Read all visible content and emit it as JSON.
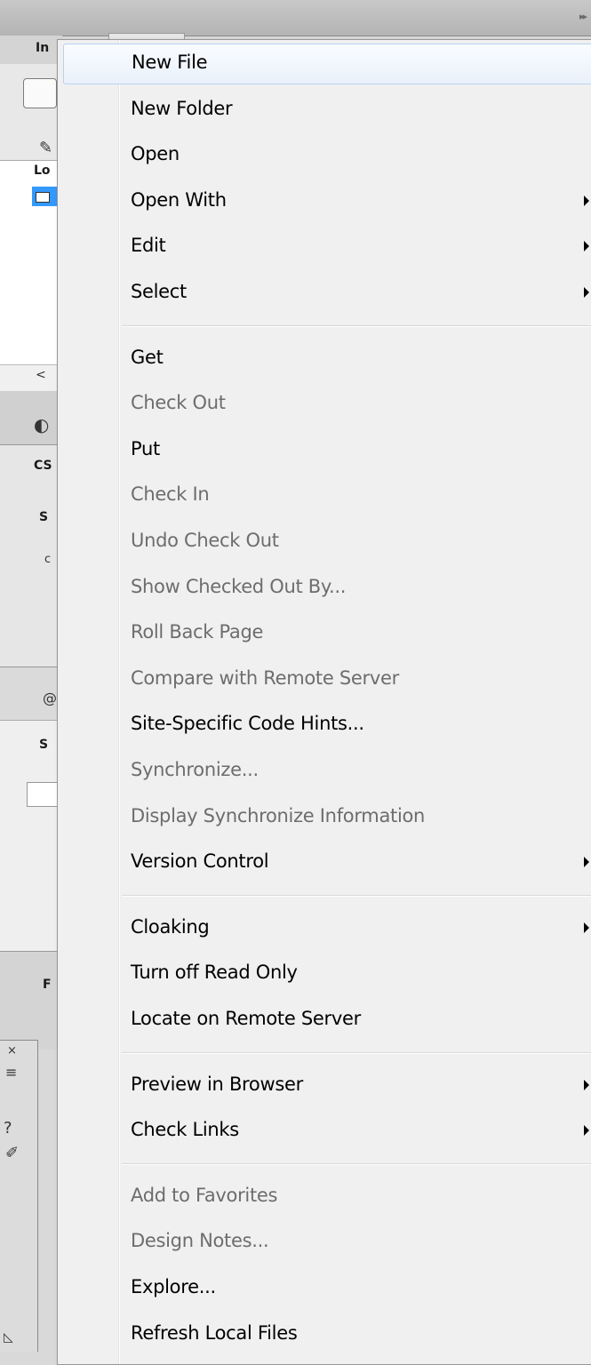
{
  "background_panel": {
    "fragments": [
      "In",
      "Lo",
      "CS",
      "S",
      "S",
      "F",
      "c",
      "<",
      "@"
    ]
  },
  "menu": {
    "groups": [
      [
        {
          "label": "New File",
          "enabled": true,
          "submenu": false,
          "hovered": true
        },
        {
          "label": "New Folder",
          "enabled": true,
          "submenu": false
        },
        {
          "label": "Open",
          "enabled": true,
          "submenu": false
        },
        {
          "label": "Open With",
          "enabled": true,
          "submenu": true
        },
        {
          "label": "Edit",
          "enabled": true,
          "submenu": true
        },
        {
          "label": "Select",
          "enabled": true,
          "submenu": true
        }
      ],
      [
        {
          "label": "Get",
          "enabled": true,
          "submenu": false
        },
        {
          "label": "Check Out",
          "enabled": false,
          "submenu": false
        },
        {
          "label": "Put",
          "enabled": true,
          "submenu": false
        },
        {
          "label": "Check In",
          "enabled": false,
          "submenu": false
        },
        {
          "label": "Undo Check Out",
          "enabled": false,
          "submenu": false
        },
        {
          "label": "Show Checked Out By...",
          "enabled": false,
          "submenu": false
        },
        {
          "label": "Roll Back Page",
          "enabled": false,
          "submenu": false
        },
        {
          "label": "Compare with Remote Server",
          "enabled": false,
          "submenu": false
        },
        {
          "label": "Site-Specific Code Hints...",
          "enabled": true,
          "submenu": false
        },
        {
          "label": "Synchronize...",
          "enabled": false,
          "submenu": false
        },
        {
          "label": "Display Synchronize Information",
          "enabled": false,
          "submenu": false
        },
        {
          "label": "Version Control",
          "enabled": true,
          "submenu": true
        }
      ],
      [
        {
          "label": "Cloaking",
          "enabled": true,
          "submenu": true
        },
        {
          "label": "Turn off Read Only",
          "enabled": true,
          "submenu": false
        },
        {
          "label": "Locate on Remote Server",
          "enabled": true,
          "submenu": false
        }
      ],
      [
        {
          "label": "Preview in Browser",
          "enabled": true,
          "submenu": true
        },
        {
          "label": "Check Links",
          "enabled": true,
          "submenu": true
        }
      ],
      [
        {
          "label": "Add to Favorites",
          "enabled": false,
          "submenu": false
        },
        {
          "label": "Design Notes...",
          "enabled": false,
          "submenu": false
        },
        {
          "label": "Explore...",
          "enabled": true,
          "submenu": false
        },
        {
          "label": "Refresh Local Files",
          "enabled": true,
          "submenu": false
        }
      ]
    ]
  },
  "colors": {
    "menu_bg": "#f0f0f0",
    "text_enabled": "#000000",
    "text_disabled": "#6d6d6d",
    "hover_border": "#b8d2f0",
    "selection_blue": "#3399ff"
  }
}
